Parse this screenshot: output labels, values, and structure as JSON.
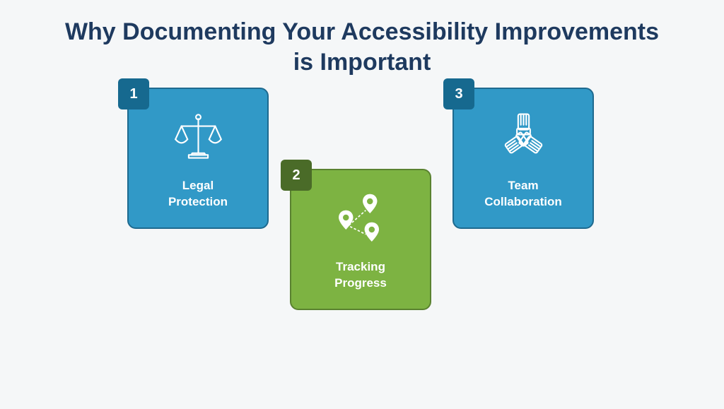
{
  "title": "Why Documenting Your Accessibility Improvements is Important",
  "cards": [
    {
      "number": "1",
      "label": "Legal\nProtection",
      "iconName": "scales-icon",
      "bgColorKey": "blue",
      "badgeColorKey": "blue"
    },
    {
      "number": "2",
      "label": "Tracking\nProgress",
      "iconName": "map-pins-icon",
      "bgColorKey": "green",
      "badgeColorKey": "green"
    },
    {
      "number": "3",
      "label": "Team\nCollaboration",
      "iconName": "hands-together-icon",
      "bgColorKey": "blue",
      "badgeColorKey": "blue"
    }
  ],
  "colors": {
    "blue": "#3199c7",
    "green": "#7db342",
    "badgeBlue": "#16698f",
    "badgeGreen": "#4a6b28",
    "titleColor": "#1e3a5f"
  }
}
